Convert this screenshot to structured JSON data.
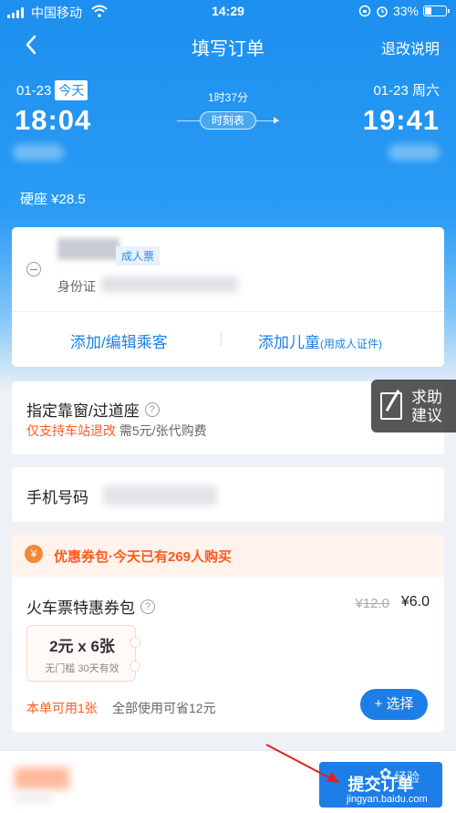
{
  "status_bar": {
    "carrier": "中国移动",
    "time": "14:29",
    "battery": "33%",
    "battery_level": 0.33
  },
  "nav": {
    "title": "填写订单",
    "refund_info": "退改说明"
  },
  "train": {
    "dep_date": "01-23",
    "today": "今天",
    "dep_time": "18:04",
    "duration": "1时37分",
    "schedule": "时刻表",
    "arr_date": "01-23 周六",
    "arr_time": "19:41",
    "seat_price": "硬座 ¥28.5"
  },
  "passenger": {
    "ticket_type": "成人票",
    "id_label": "身份证",
    "add_edit": "添加/编辑乘客",
    "add_child": "添加儿童",
    "add_child_note": "(用成人证件)"
  },
  "window_seat": {
    "title": "指定靠窗/过道座",
    "help": "?",
    "warn": "仅支持车站退改",
    "fee": " 需5元/张代购费"
  },
  "feedback": {
    "label": "求助建议"
  },
  "phone": {
    "label": "手机号码"
  },
  "coupon": {
    "header": "优惠券包·今天已有269人购买",
    "title": "火车票特惠券包",
    "help": "?",
    "orig_price": "¥12.0",
    "now_price": "¥6.0",
    "voucher_main": "2元 x 6张",
    "voucher_sub": "无门槛 30天有效",
    "usable": "本单可用1张",
    "save_note": "全部使用可省12元",
    "choose": "+ 选择"
  },
  "bottom": {
    "submit": "提交订单"
  },
  "watermark": {
    "text": "经验",
    "url": "jingyan.baidu.com"
  },
  "colors": {
    "primary": "#1c7ee6",
    "warn": "#ff5a1f"
  }
}
